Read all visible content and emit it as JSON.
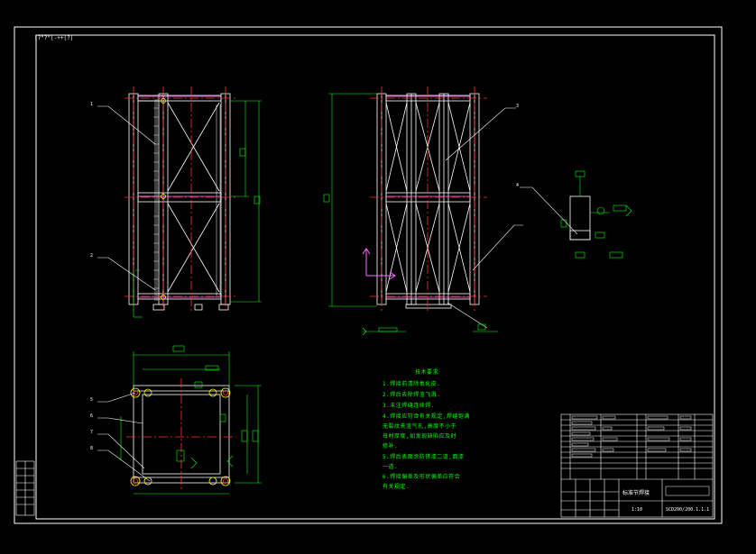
{
  "drawing": {
    "corner_label": "[?\"?\"[-++[?]",
    "leaders": [
      "1",
      "2",
      "3",
      "4",
      "5",
      "6",
      "7",
      "8"
    ],
    "notes": {
      "title": "技术要求",
      "lines": [
        "1.焊接前清除氧化皮.",
        "2.焊后去除焊渣飞溅.",
        "3.未注焊缝连续焊.",
        "4.焊接应符合有关规定,焊缝饱满",
        "  无裂纹夹渣气孔,高度不小于",
        "  母材厚度,如发现缺陷应及时",
        "  修补.",
        "5.焊后表面涂防锈漆二道,面漆",
        "  一道.",
        "6.焊接偏差及形状偏差应符合",
        "  有关规定."
      ]
    },
    "title_block": {
      "name": "标准节焊接",
      "scale": "1:10",
      "code": "SCD200/200.1.1.1"
    }
  },
  "colors": {
    "frame": "#ffffff",
    "structure": "#ffffff",
    "centerline": "#ff3333",
    "dimension": "#00ff00",
    "purple": "#ff66ff",
    "yellow": "#ffff00"
  }
}
